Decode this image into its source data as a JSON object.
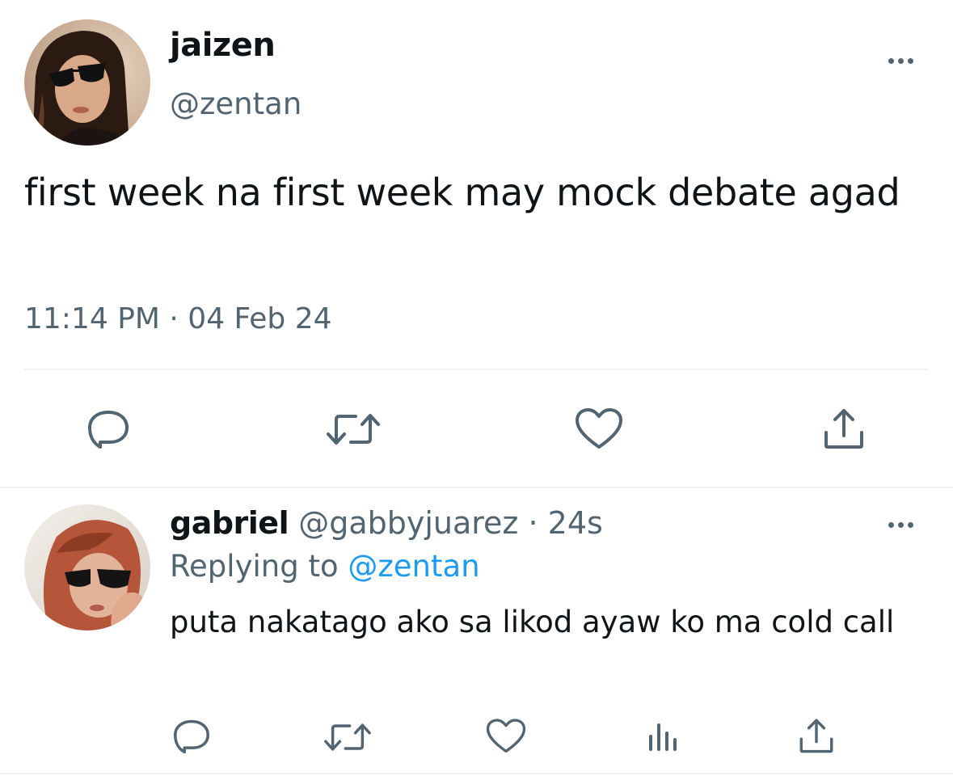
{
  "main_tweet": {
    "display_name": "jaizen",
    "handle": "@zentan",
    "text": "first week na first week may mock debate agad",
    "timestamp": "11:14 PM · 04 Feb 24",
    "actions": [
      "reply-icon",
      "retweet-icon",
      "like-icon",
      "share-icon"
    ]
  },
  "reply": {
    "display_name": "gabriel",
    "handle": "@gabbyjuarez",
    "separator": "·",
    "time": "24s",
    "replying_label": "Replying to",
    "replying_to": "@zentan",
    "text": "puta nakatago ako sa likod ayaw ko ma cold call",
    "actions": [
      "reply-icon",
      "retweet-icon",
      "like-icon",
      "views-icon",
      "share-icon"
    ]
  },
  "colors": {
    "text_primary": "#0f1419",
    "text_secondary": "#536471",
    "accent": "#1d9bf0",
    "divider": "#eff3f4"
  }
}
